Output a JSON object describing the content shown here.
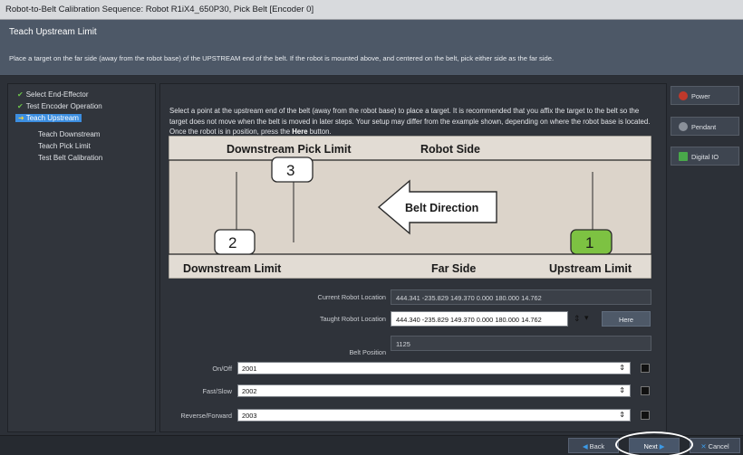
{
  "window": {
    "title": "Robot-to-Belt Calibration Sequence: Robot R1iX4_650P30, Pick Belt [Encoder 0]"
  },
  "header": {
    "title": "Teach Upstream Limit",
    "description": "Place a target on the far side (away from the robot base) of the UPSTREAM end of the belt. If the robot is mounted above, and centered on the belt, pick either side as the far side."
  },
  "steps": [
    {
      "label": "Select End-Effector",
      "state": "done"
    },
    {
      "label": "Test Encoder Operation",
      "state": "done"
    },
    {
      "label": "Teach Upstream",
      "state": "current"
    },
    {
      "label": "Teach Downstream",
      "state": "pending"
    },
    {
      "label": "Teach Pick Limit",
      "state": "pending"
    },
    {
      "label": "Test Belt Calibration",
      "state": "pending"
    }
  ],
  "instructions": {
    "text": "Select a point at the upstream end of the belt (away from the robot base) to place a target. It is recommended that you affix the target to the belt so the target does not move when the belt is moved in later steps. Your setup may differ from the example shown, depending on where the robot base is located. Once the robot is in position, press the ",
    "bold": "Here",
    "end": " button."
  },
  "diagram": {
    "downstream_pick_limit": "Downstream Pick Limit",
    "robot_side": "Robot Side",
    "belt_direction": "Belt Direction",
    "downstream_limit": "Downstream Limit",
    "far_side": "Far Side",
    "upstream_limit": "Upstream Limit",
    "marker_1": "1",
    "marker_2": "2",
    "marker_3": "3",
    "marker_1_color": "#7dc242"
  },
  "fields": {
    "current_label": "Current Robot Location",
    "current_value": "444.341 -235.829 149.370 0.000 180.000 14.762",
    "taught_label": "Taught Robot Location",
    "taught_value": "444.340 -235.829 149.370 0.000 180.000 14.762",
    "here_button": "Here",
    "belt_label": "Belt Position",
    "belt_value": "1125"
  },
  "io": [
    {
      "label": "On/Off",
      "value": "2001"
    },
    {
      "label": "Fast/Slow",
      "value": "2002"
    },
    {
      "label": "Reverse/Forward",
      "value": "2003"
    }
  ],
  "side_buttons": [
    {
      "label": "Power",
      "icon": "power-icon",
      "color": "#c0392b"
    },
    {
      "label": "Pendant",
      "icon": "pendant-icon",
      "color": "#8a9099"
    },
    {
      "label": "Digital IO",
      "icon": "digital-io-icon",
      "color": "#49a84a"
    }
  ],
  "nav": {
    "back": "Back",
    "next": "Next",
    "cancel": "Cancel"
  }
}
